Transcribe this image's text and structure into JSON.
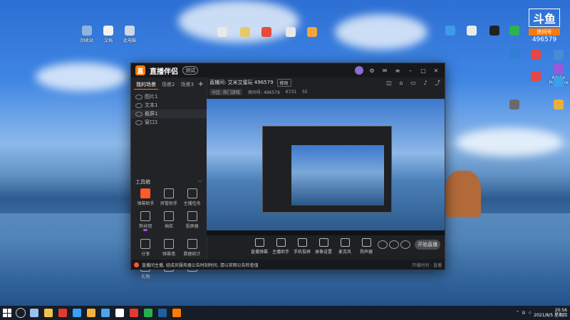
{
  "wallpaper_accent": "#ff7a00",
  "desktop": {
    "icons_left": [
      {
        "label": "回收站",
        "color": "#8fb4e0"
      },
      {
        "label": "文档",
        "color": "#f1f1f1"
      },
      {
        "label": "此电脑",
        "color": "#cfd8e6"
      },
      {
        "label": "",
        "color": "#e8e8e8"
      },
      {
        "label": "",
        "color": "#e8c86a"
      },
      {
        "label": "",
        "color": "#e64b3c"
      },
      {
        "label": "",
        "color": "#e8e8e8"
      },
      {
        "label": "",
        "color": "#f2a63b"
      }
    ],
    "icons_right": [
      {
        "label": "",
        "color": "#3d9be9"
      },
      {
        "label": "",
        "color": "#eaeaea"
      },
      {
        "label": "",
        "color": "#222"
      },
      {
        "label": "",
        "color": "#2fb24c"
      },
      {
        "label": "",
        "color": "#e84545"
      },
      {
        "label": "",
        "color": "#4a8bd8"
      },
      {
        "label": "Adobe Premiere",
        "color": "#9a59d8"
      },
      {
        "label": "",
        "color": "#2f7fd6"
      },
      {
        "label": "",
        "color": "#e84545"
      },
      {
        "label": "",
        "color": "#3aa0e8"
      },
      {
        "label": "",
        "color": "#6a6a6a"
      },
      {
        "label": "",
        "color": "#e8b23a"
      }
    ],
    "douyu": {
      "mark": "斗鱼",
      "room_label": "房间号",
      "room_number": "496579"
    }
  },
  "app": {
    "title": "直播伴侣",
    "version_badge": "测试",
    "left_tabs": [
      {
        "label": "我的场景",
        "active": true
      },
      {
        "label": "场景2",
        "active": false
      },
      {
        "label": "场景3",
        "active": false
      }
    ],
    "add_tab": "+",
    "scenes": [
      {
        "label": "图片1",
        "selected": false
      },
      {
        "label": "文本1",
        "selected": false
      },
      {
        "label": "截屏1",
        "selected": true
      },
      {
        "label": "窗口1",
        "selected": false
      }
    ],
    "tools_title": "工具箱",
    "tools_more": "⋯",
    "tools": [
      {
        "label": "弹幕助手",
        "hot": true
      },
      {
        "label": "房管助手",
        "hot": false
      },
      {
        "label": "主播任务",
        "hot": false
      },
      {
        "label": "粉丝团",
        "hot": false,
        "pip": true
      },
      {
        "label": "抽奖",
        "hot": false
      },
      {
        "label": "投屏器",
        "hot": false
      },
      {
        "label": "分享",
        "hot": false
      },
      {
        "label": "弹幕墙",
        "hot": false
      },
      {
        "label": "数据统计",
        "hot": false
      },
      {
        "label": "礼物",
        "hot": false
      },
      {
        "label": "",
        "hot": false
      },
      {
        "label": "",
        "hot": false
      }
    ],
    "room_title": "直播间: 艾米艾蜜玩 496579",
    "room_edit": "修改",
    "room_info": [
      {
        "label": "分区: 热门游戏",
        "chip": true
      },
      {
        "label": "房间号: 496579",
        "chip": false
      },
      {
        "label": "6731",
        "chip": false
      },
      {
        "label": "55",
        "chip": false
      }
    ],
    "controls": [
      {
        "label": "直播弹幕"
      },
      {
        "label": "主播助手"
      },
      {
        "label": "手机投屏"
      },
      {
        "label": "录像设置"
      },
      {
        "label": "麦克风"
      },
      {
        "label": "扬声器"
      }
    ],
    "start_button": "开始直播",
    "notice": "直播间主播, 组成员服务器公告时刻时间, 请以官网公告检查值",
    "notice_meta": "开播时间 · 直播"
  },
  "taskbar": {
    "apps": [
      {
        "color": "#9bc0f0"
      },
      {
        "color": "#f0c34a"
      },
      {
        "color": "#e23b2e"
      },
      {
        "color": "#33a3ff"
      },
      {
        "color": "#f4b33a"
      },
      {
        "color": "#4aa4ee"
      },
      {
        "color": "#ffffff"
      },
      {
        "color": "#e23b2e"
      },
      {
        "color": "#23b14d"
      },
      {
        "color": "#1f5f9f"
      },
      {
        "color": "#ff7a00"
      }
    ],
    "time": "20:56",
    "date": "2021/8/5 星期四"
  }
}
